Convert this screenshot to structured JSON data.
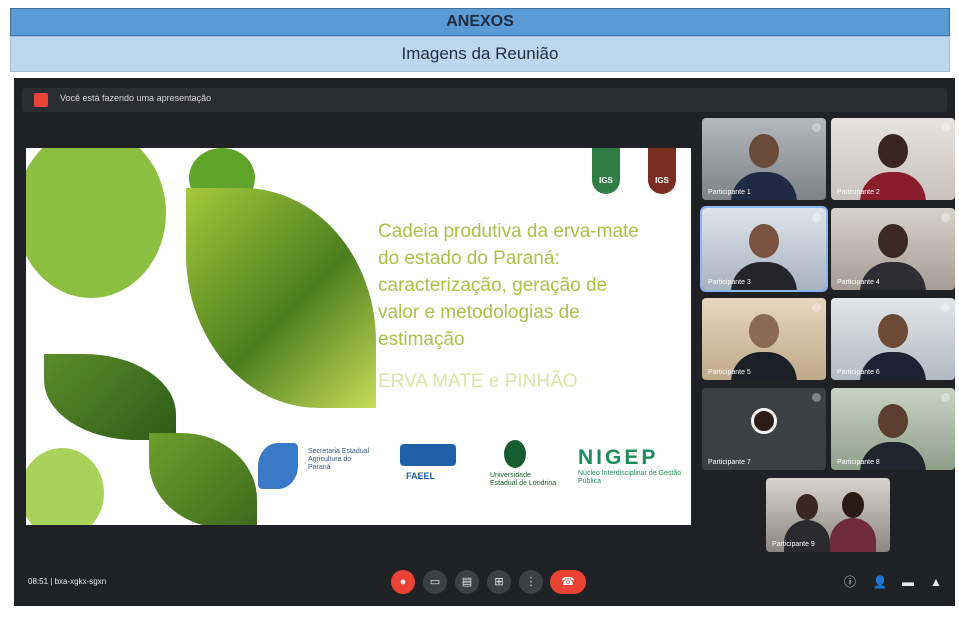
{
  "header": {
    "title": "ANEXOS",
    "subtitle": "Imagens da Reunião"
  },
  "meeting": {
    "presenting_text": "Você está fazendo uma apresentação",
    "slide": {
      "title_lines": [
        "Cadeia produtiva da erva-mate",
        "do estado do Paraná:",
        "caracterização, geração de",
        "valor e metodologias de",
        "estimação"
      ],
      "subtitle": "ERVA MATE e PINHÃO",
      "badges": [
        "IGS",
        "IGS"
      ],
      "logos": {
        "logo1": "Secretaria Estadual Agricultura do Paraná",
        "logo2": "FAEEL",
        "logo3": "Universidade Estadual de Londrina",
        "nigep": "NIGEP",
        "nigep_sub": "Núcleo Interdisciplinar de Gestão Pública"
      }
    },
    "participants": [
      {
        "name": "Participante 1"
      },
      {
        "name": "Participante 2"
      },
      {
        "name": "Participante 3"
      },
      {
        "name": "Participante 4"
      },
      {
        "name": "Participante 5"
      },
      {
        "name": "Participante 6"
      },
      {
        "name": "Participante 7"
      },
      {
        "name": "Participante 8"
      },
      {
        "name": "Participante 9"
      }
    ],
    "bottom": {
      "time": "08:51",
      "meeting_code": "bxa-xgkx-sgxn"
    }
  },
  "colors": {
    "header_blue": "#5b9bd5",
    "header_light": "#bdd7ee",
    "meet_dark": "#202124",
    "red": "#ea4335",
    "leaf_green": "#8cbf3f"
  }
}
